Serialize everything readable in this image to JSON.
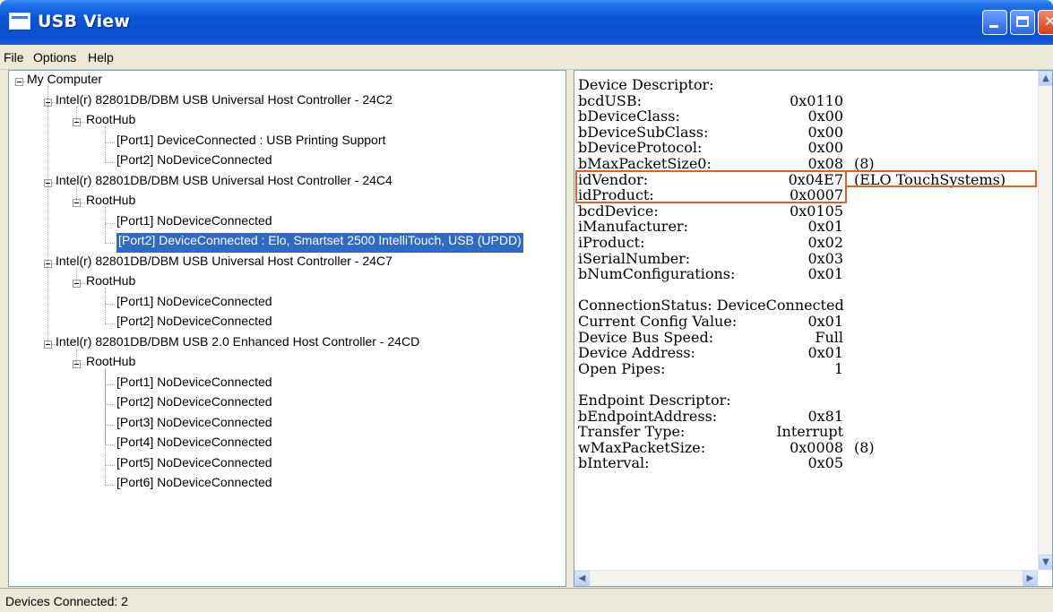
{
  "window": {
    "title": "USB View",
    "icon": "usb-view-app-icon"
  },
  "menu": [
    "File",
    "Options",
    "Help"
  ],
  "tree": [
    {
      "label": "My Computer",
      "level": 0,
      "expander": true
    },
    {
      "label": "Intel(r) 82801DB/DBM USB Universal Host Controller - 24C2",
      "level": 1,
      "expander": true
    },
    {
      "label": "RootHub",
      "level": 2,
      "expander": true
    },
    {
      "label": "[Port1] DeviceConnected :  USB Printing Support",
      "level": 3
    },
    {
      "label": "[Port2] NoDeviceConnected",
      "level": 3
    },
    {
      "label": "Intel(r) 82801DB/DBM USB Universal Host Controller - 24C4",
      "level": 1,
      "expander": true
    },
    {
      "label": "RootHub",
      "level": 2,
      "expander": true
    },
    {
      "label": "[Port1] NoDeviceConnected",
      "level": 3
    },
    {
      "label": "[Port2] DeviceConnected :  Elo, Smartset 2500 IntelliTouch, USB (UPDD)",
      "level": 3,
      "selected": true
    },
    {
      "label": "Intel(r) 82801DB/DBM USB Universal Host Controller - 24C7",
      "level": 1,
      "expander": true
    },
    {
      "label": "RootHub",
      "level": 2,
      "expander": true
    },
    {
      "label": "[Port1] NoDeviceConnected",
      "level": 3
    },
    {
      "label": "[Port2] NoDeviceConnected",
      "level": 3
    },
    {
      "label": "Intel(r) 82801DB/DBM USB 2.0 Enhanced Host Controller - 24CD",
      "level": 1,
      "expander": true
    },
    {
      "label": "RootHub",
      "level": 2,
      "expander": true
    },
    {
      "label": "[Port1] NoDeviceConnected",
      "level": 3
    },
    {
      "label": "[Port2] NoDeviceConnected",
      "level": 3
    },
    {
      "label": "[Port3] NoDeviceConnected",
      "level": 3
    },
    {
      "label": "[Port4] NoDeviceConnected",
      "level": 3
    },
    {
      "label": "[Port5] NoDeviceConnected",
      "level": 3
    },
    {
      "label": "[Port6] NoDeviceConnected",
      "level": 3
    }
  ],
  "details": [
    {
      "field": "Device Descriptor:",
      "value": "",
      "extra": ""
    },
    {
      "field": "bcdUSB:",
      "value": "0x0110",
      "extra": ""
    },
    {
      "field": "bDeviceClass:",
      "value": "0x00",
      "extra": ""
    },
    {
      "field": "bDeviceSubClass:",
      "value": "0x00",
      "extra": ""
    },
    {
      "field": "bDeviceProtocol:",
      "value": "0x00",
      "extra": ""
    },
    {
      "field": "bMaxPacketSize0:",
      "value": "0x08",
      "extra": "(8)"
    },
    {
      "field": "idVendor:",
      "value": "0x04E7",
      "extra": "(ELO TouchSystems)",
      "highlight": true
    },
    {
      "field": "idProduct:",
      "value": "0x0007",
      "extra": "",
      "highlight": true
    },
    {
      "field": "bcdDevice:",
      "value": "0x0105",
      "extra": ""
    },
    {
      "field": "iManufacturer:",
      "value": "0x01",
      "extra": ""
    },
    {
      "field": "iProduct:",
      "value": "0x02",
      "extra": ""
    },
    {
      "field": "iSerialNumber:",
      "value": "0x03",
      "extra": ""
    },
    {
      "field": "bNumConfigurations:",
      "value": "0x01",
      "extra": ""
    },
    {
      "field": "",
      "value": "",
      "extra": ""
    },
    {
      "field": "ConnectionStatus: DeviceConnected",
      "value": "",
      "extra": ""
    },
    {
      "field": "Current Config Value:",
      "value": "0x01",
      "extra": ""
    },
    {
      "field": "Device Bus Speed:",
      "value": "Full",
      "extra": ""
    },
    {
      "field": "Device Address:",
      "value": "0x01",
      "extra": ""
    },
    {
      "field": "Open Pipes:",
      "value": "1",
      "extra": ""
    },
    {
      "field": "",
      "value": "",
      "extra": ""
    },
    {
      "field": "Endpoint Descriptor:",
      "value": "",
      "extra": ""
    },
    {
      "field": "bEndpointAddress:",
      "value": "0x81",
      "extra": ""
    },
    {
      "field": "Transfer Type:",
      "value": "Interrupt",
      "extra": ""
    },
    {
      "field": "wMaxPacketSize:",
      "value": "0x0008",
      "extra": "(8)"
    },
    {
      "field": "bInterval:",
      "value": "0x05",
      "extra": ""
    }
  ],
  "status": {
    "text": "Devices Connected: 2"
  },
  "colors": {
    "selection": "#316ac5",
    "highlight_border": "#e0602a",
    "titlebar": "#0a56d8"
  }
}
